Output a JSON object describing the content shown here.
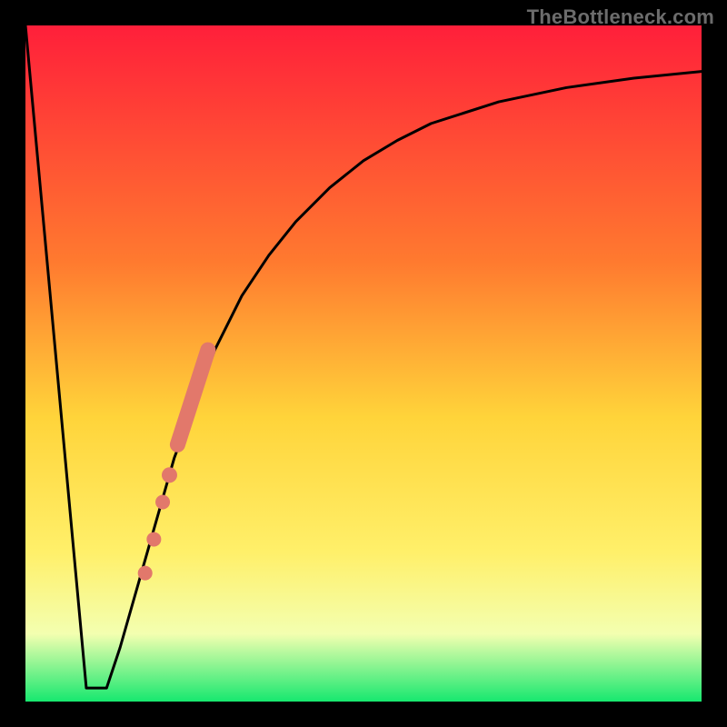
{
  "watermark": "TheBottleneck.com",
  "colors": {
    "frame": "#000000",
    "watermark": "#6c6c6c",
    "gradient_top": "#ff1f3a",
    "gradient_mid_upper": "#ff7a2f",
    "gradient_mid": "#ffd43a",
    "gradient_mid_lower": "#fff06a",
    "gradient_lower": "#f3ffb0",
    "gradient_bottom": "#17e86f",
    "curve": "#000000",
    "marker_fill": "#e2786b",
    "marker_stroke": "#c9584b"
  },
  "chart_data": {
    "type": "line",
    "title": "",
    "xlabel": "",
    "ylabel": "",
    "xlim": [
      0,
      100
    ],
    "ylim": [
      0,
      100
    ],
    "grid": false,
    "series": [
      {
        "name": "left-segment",
        "x": [
          0,
          9,
          11,
          12
        ],
        "values": [
          100,
          2,
          2,
          2
        ]
      },
      {
        "name": "right-segment",
        "x": [
          12,
          14,
          16,
          18,
          20,
          22,
          25,
          28,
          32,
          36,
          40,
          45,
          50,
          55,
          60,
          70,
          80,
          90,
          100
        ],
        "values": [
          2,
          8,
          15,
          22,
          29,
          36,
          44,
          52,
          60,
          66,
          71,
          76,
          80,
          83,
          85.5,
          88.7,
          90.8,
          92.2,
          93.2
        ]
      }
    ],
    "markers": {
      "thick_segment": {
        "x": [
          22.5,
          27.0
        ],
        "y": [
          38,
          52
        ]
      },
      "dots": [
        {
          "x": 21.3,
          "y": 33.5
        },
        {
          "x": 20.3,
          "y": 29.5
        },
        {
          "x": 19.0,
          "y": 24.0
        },
        {
          "x": 17.7,
          "y": 19.0
        }
      ]
    }
  }
}
